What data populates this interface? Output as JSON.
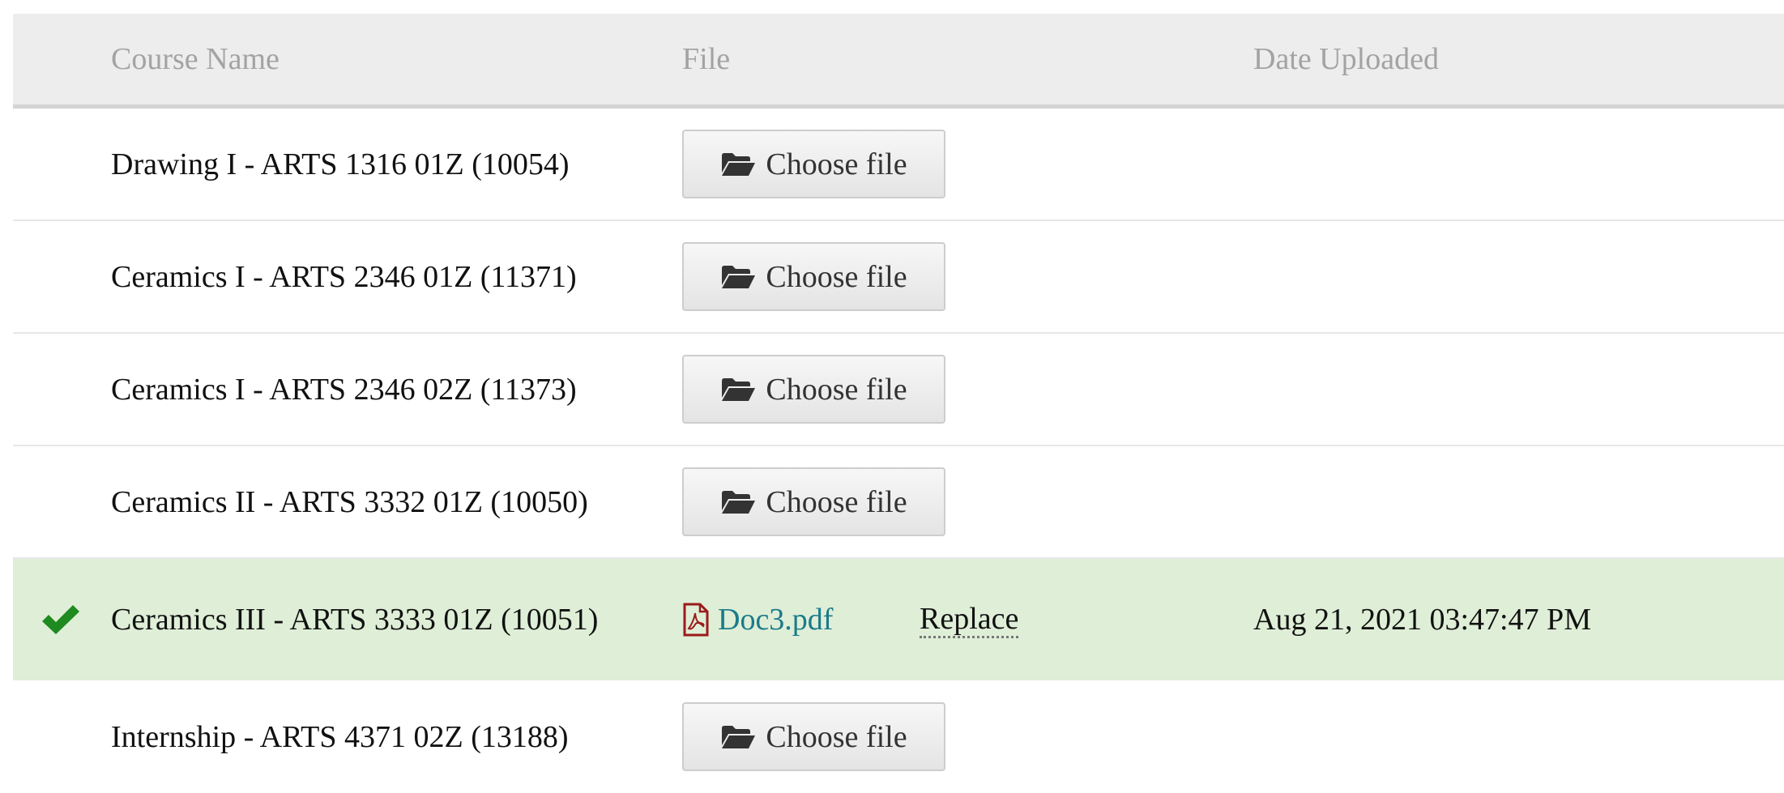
{
  "table": {
    "headers": {
      "course": "Course Name",
      "file": "File",
      "date": "Date Uploaded"
    },
    "choose_file_label": "Choose file",
    "replace_label": "Replace",
    "rows": [
      {
        "course": "Drawing I - ARTS 1316 01Z (10054)",
        "status": "empty"
      },
      {
        "course": "Ceramics I - ARTS 2346 01Z (11371)",
        "status": "empty"
      },
      {
        "course": "Ceramics I - ARTS 2346 02Z (11373)",
        "status": "empty"
      },
      {
        "course": "Ceramics II - ARTS 3332 01Z (10050)",
        "status": "empty"
      },
      {
        "course": "Ceramics III - ARTS 3333 01Z (10051)",
        "status": "uploaded",
        "file_name": "Doc3.pdf",
        "date_uploaded": "Aug 21, 2021 03:47:47 PM"
      },
      {
        "course": "Internship - ARTS 4371 02Z (13188)",
        "status": "empty"
      }
    ]
  },
  "colors": {
    "uploaded_row_bg": "#dfeed7",
    "check_green": "#1f8a1f",
    "link_teal": "#1a7b8a",
    "pdf_red": "#9b1b1b"
  },
  "icons": {
    "choose": "folder-open-icon",
    "uploaded": "checkmark-icon",
    "file": "pdf-file-icon"
  }
}
